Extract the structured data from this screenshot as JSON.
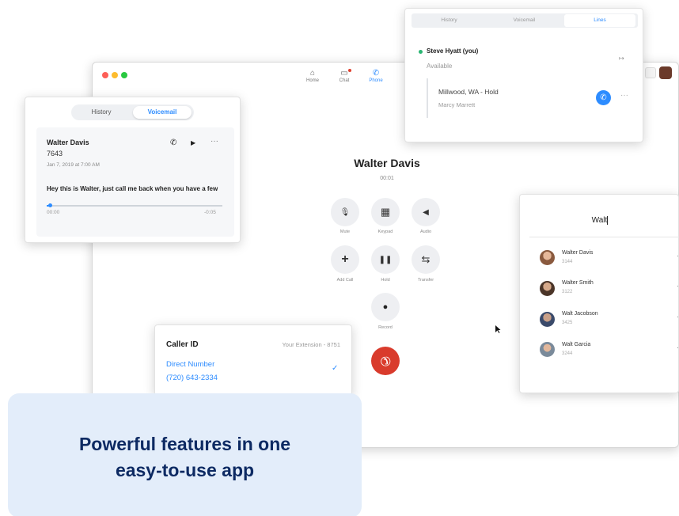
{
  "main_window": {
    "nav": [
      {
        "label": "Home",
        "icon": "home-icon",
        "glyph": "⌂"
      },
      {
        "label": "Chat",
        "icon": "chat-icon",
        "glyph": "▭"
      },
      {
        "label": "Phone",
        "icon": "phone-icon",
        "glyph": "✆"
      }
    ]
  },
  "call": {
    "name": "Walter Davis",
    "timer": "00:01",
    "controls": [
      {
        "label": "Mute",
        "icon": "microphone-icon",
        "glyph": "🎙"
      },
      {
        "label": "Keypad",
        "icon": "keypad-icon",
        "glyph": "▦"
      },
      {
        "label": "Audio",
        "icon": "speaker-icon",
        "glyph": "◀"
      },
      {
        "label": "Add Call",
        "icon": "plus-icon",
        "glyph": "+"
      },
      {
        "label": "Hold",
        "icon": "pause-icon",
        "glyph": "❚❚"
      },
      {
        "label": "Transfer",
        "icon": "transfer-icon",
        "glyph": "⇆"
      },
      {
        "label": "Record",
        "icon": "record-icon",
        "glyph": "●"
      }
    ]
  },
  "voicemail": {
    "tabs": [
      "History",
      "Voicemail"
    ],
    "active_tab": "Voicemail",
    "caller": "Walter Davis",
    "number": "7643",
    "date": "Jan 7, 2019 at 7:00 AM",
    "message": "Hey this is Walter, just call me back when you have a few",
    "time_start": "00:00",
    "time_end": "-0:05",
    "progress": 0.02
  },
  "lines": {
    "tabs": [
      "History",
      "Voicemail",
      "Lines"
    ],
    "active_tab": "Lines",
    "user": "Steve Hyatt (you)",
    "status": "Available",
    "line_title": "Millwood, WA - Hold",
    "line_sub": "Marcy Marrett"
  },
  "search": {
    "query": "Walt",
    "contacts": [
      {
        "name": "Walter Davis",
        "ext": "3144"
      },
      {
        "name": "Walter Smith",
        "ext": "3122"
      },
      {
        "name": "Walt Jacobson",
        "ext": "3425"
      },
      {
        "name": "Walt Garcia",
        "ext": "3244"
      }
    ]
  },
  "caller_id": {
    "title": "Caller ID",
    "extension": "Your Extension - 8751",
    "label": "Direct Number",
    "number": "(720) 643-2334"
  },
  "banner": {
    "line1": "Powerful features in one",
    "line2": "easy-to-use app"
  },
  "colors": {
    "accent": "#2d8cff",
    "end_call": "#d93b2c",
    "banner_bg": "#e3edfa",
    "banner_text": "#0d2a63",
    "status_green": "#2bb673"
  }
}
